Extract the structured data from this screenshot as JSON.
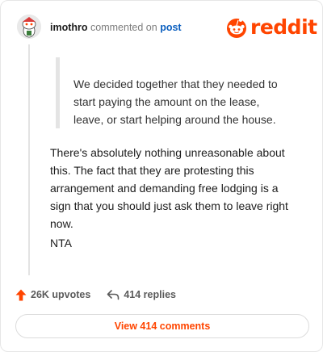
{
  "header": {
    "username": "imothro",
    "commented_on": "commented on",
    "post_link": "post",
    "brand": "reddit"
  },
  "quote": {
    "lines": [
      "We decided together that they needed to",
      "start paying the amount on the lease,",
      "leave, or start helping around the house."
    ]
  },
  "comment": {
    "lines": [
      "There's absolutely nothing unreasonable about",
      "this. The fact that they are protesting this",
      "arrangement and demanding free lodging is a",
      "sign that you should just ask them to leave right",
      "now."
    ],
    "verdict": "NTA"
  },
  "stats": {
    "upvotes": "26K upvotes",
    "replies": "414 replies"
  },
  "view_comments_label": "View 414 comments",
  "colors": {
    "brand": "#ff4500",
    "link": "#0b5fbf",
    "muted": "#7c7c7c"
  },
  "icons": {
    "avatar": "snoo-avatar",
    "logo": "reddit-snoo-icon",
    "upvote": "upvote-arrow-icon",
    "reply": "reply-arrow-icon"
  }
}
